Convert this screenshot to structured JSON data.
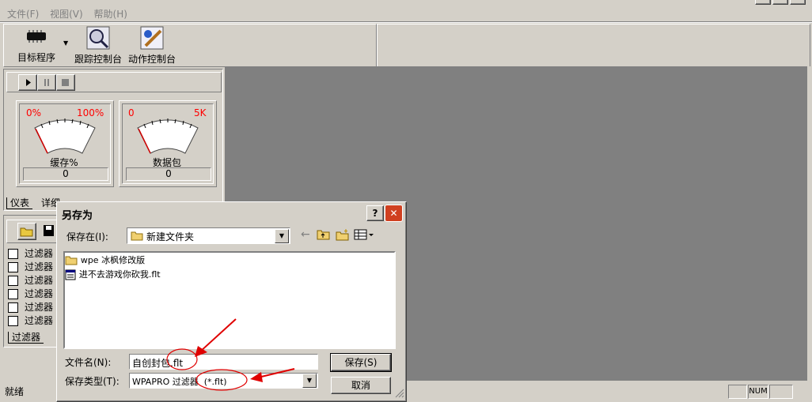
{
  "menu": {
    "file": "文件(F)",
    "view": "视图(V)",
    "help": "帮助(H)"
  },
  "toolbar": {
    "target": "目标程序",
    "trace": "跟踪控制台",
    "action": "动作控制台"
  },
  "gauges": [
    {
      "min": "0%",
      "max": "100%",
      "caption": "缓存%",
      "value": "0"
    },
    {
      "min": "0",
      "max": "5K",
      "caption": "数据包",
      "value": "0"
    }
  ],
  "tabs_top": {
    "instrument": "仪表",
    "detail": "详细"
  },
  "filters": {
    "items": [
      "过滤器",
      "过滤器",
      "过滤器",
      "过滤器",
      "过滤器",
      "过滤器"
    ],
    "tab": "过滤器"
  },
  "status": {
    "ready": "就绪",
    "num": "NUM"
  },
  "dialog": {
    "title": "另存为",
    "save_in_label": "保存在(I):",
    "save_in_value": "新建文件夹",
    "files": [
      {
        "name": "wpe 冰枫修改版",
        "icon": "folder-icon"
      },
      {
        "name": "进不去游戏你砍我.flt",
        "icon": "file-icon"
      }
    ],
    "filename_label": "文件名(N):",
    "filename_value": "自创封包.flt",
    "filetype_label": "保存类型(T):",
    "filetype_value": "WPAPRO 过滤器  (*.flt)",
    "save_button": "保存(S)",
    "cancel_button": "取消",
    "help_btn": "?",
    "close_btn": "✕"
  },
  "colors": {
    "workspace": "#808080",
    "annotation": "#e00000",
    "gauge_text": "#ff0000"
  }
}
